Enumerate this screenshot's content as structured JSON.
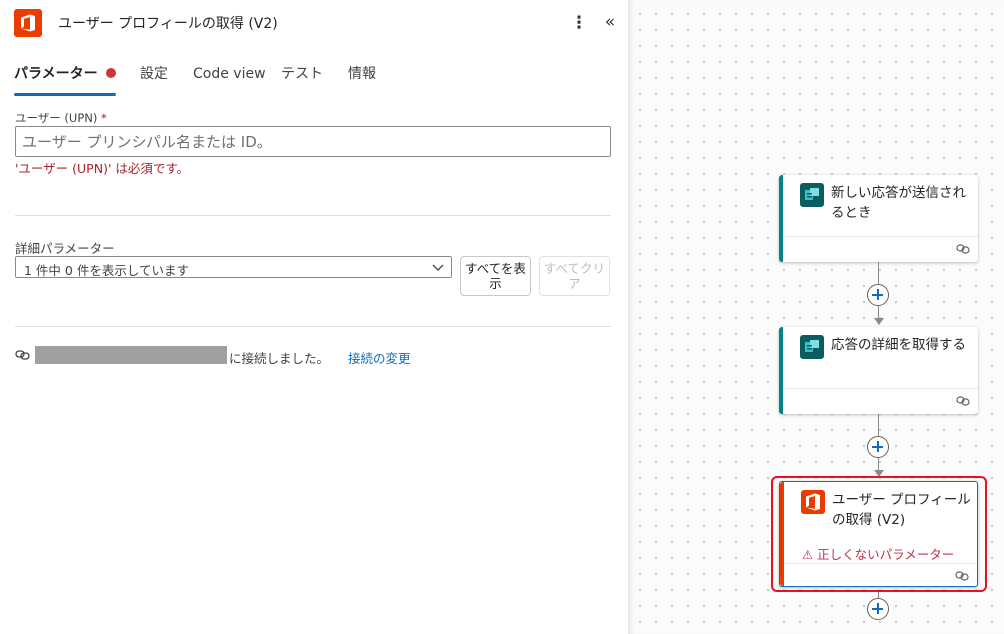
{
  "panel": {
    "title": "ユーザー プロフィールの取得 (V2)",
    "more_icon": "⋮",
    "collapse_icon": "«"
  },
  "tabs": [
    {
      "label": "パラメーター",
      "active": true,
      "has_error": true
    },
    {
      "label": "設定"
    },
    {
      "label": "Code view"
    },
    {
      "label": "テスト"
    },
    {
      "label": "情報"
    }
  ],
  "upn_field": {
    "label": "ユーザー (UPN)",
    "required_mark": "*",
    "placeholder": "ユーザー プリンシパル名または ID。",
    "value": "",
    "error": "'ユーザー (UPN)' は必須です。"
  },
  "advanced": {
    "label": "詳細パラメーター",
    "select_value": "1 件中 0 件を表示しています",
    "show_all_label": "すべてを表示",
    "clear_all_label": "すべてクリア"
  },
  "connection": {
    "status_text": "に接続しました。",
    "change_link": "接続の変更"
  },
  "colors": {
    "accent": "#0f6cbd",
    "error": "#a4262c",
    "office": "#eb3c00",
    "forms_teal": "#038387",
    "selection": "#e81123"
  },
  "flow": {
    "nodes": [
      {
        "title": "新しい応答が送信されるとき",
        "icon": "forms-icon",
        "accent": "#038387"
      },
      {
        "title": "応答の詳細を取得する",
        "icon": "forms-icon",
        "accent": "#038387"
      },
      {
        "title": "ユーザー プロフィールの取得 (V2)",
        "icon": "office-icon",
        "accent": "#eb3c00",
        "selected": true,
        "warning": "⚠ 正しくないパラメーター"
      }
    ]
  }
}
